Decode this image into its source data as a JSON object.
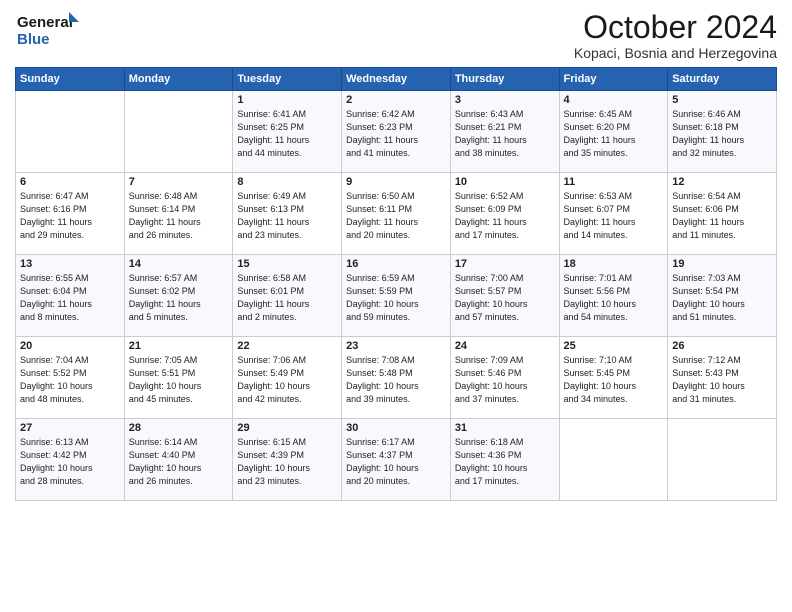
{
  "header": {
    "logo_line1": "General",
    "logo_line2": "Blue",
    "month": "October 2024",
    "location": "Kopaci, Bosnia and Herzegovina"
  },
  "weekdays": [
    "Sunday",
    "Monday",
    "Tuesday",
    "Wednesday",
    "Thursday",
    "Friday",
    "Saturday"
  ],
  "weeks": [
    [
      {
        "day": "",
        "info": ""
      },
      {
        "day": "",
        "info": ""
      },
      {
        "day": "1",
        "info": "Sunrise: 6:41 AM\nSunset: 6:25 PM\nDaylight: 11 hours\nand 44 minutes."
      },
      {
        "day": "2",
        "info": "Sunrise: 6:42 AM\nSunset: 6:23 PM\nDaylight: 11 hours\nand 41 minutes."
      },
      {
        "day": "3",
        "info": "Sunrise: 6:43 AM\nSunset: 6:21 PM\nDaylight: 11 hours\nand 38 minutes."
      },
      {
        "day": "4",
        "info": "Sunrise: 6:45 AM\nSunset: 6:20 PM\nDaylight: 11 hours\nand 35 minutes."
      },
      {
        "day": "5",
        "info": "Sunrise: 6:46 AM\nSunset: 6:18 PM\nDaylight: 11 hours\nand 32 minutes."
      }
    ],
    [
      {
        "day": "6",
        "info": "Sunrise: 6:47 AM\nSunset: 6:16 PM\nDaylight: 11 hours\nand 29 minutes."
      },
      {
        "day": "7",
        "info": "Sunrise: 6:48 AM\nSunset: 6:14 PM\nDaylight: 11 hours\nand 26 minutes."
      },
      {
        "day": "8",
        "info": "Sunrise: 6:49 AM\nSunset: 6:13 PM\nDaylight: 11 hours\nand 23 minutes."
      },
      {
        "day": "9",
        "info": "Sunrise: 6:50 AM\nSunset: 6:11 PM\nDaylight: 11 hours\nand 20 minutes."
      },
      {
        "day": "10",
        "info": "Sunrise: 6:52 AM\nSunset: 6:09 PM\nDaylight: 11 hours\nand 17 minutes."
      },
      {
        "day": "11",
        "info": "Sunrise: 6:53 AM\nSunset: 6:07 PM\nDaylight: 11 hours\nand 14 minutes."
      },
      {
        "day": "12",
        "info": "Sunrise: 6:54 AM\nSunset: 6:06 PM\nDaylight: 11 hours\nand 11 minutes."
      }
    ],
    [
      {
        "day": "13",
        "info": "Sunrise: 6:55 AM\nSunset: 6:04 PM\nDaylight: 11 hours\nand 8 minutes."
      },
      {
        "day": "14",
        "info": "Sunrise: 6:57 AM\nSunset: 6:02 PM\nDaylight: 11 hours\nand 5 minutes."
      },
      {
        "day": "15",
        "info": "Sunrise: 6:58 AM\nSunset: 6:01 PM\nDaylight: 11 hours\nand 2 minutes."
      },
      {
        "day": "16",
        "info": "Sunrise: 6:59 AM\nSunset: 5:59 PM\nDaylight: 10 hours\nand 59 minutes."
      },
      {
        "day": "17",
        "info": "Sunrise: 7:00 AM\nSunset: 5:57 PM\nDaylight: 10 hours\nand 57 minutes."
      },
      {
        "day": "18",
        "info": "Sunrise: 7:01 AM\nSunset: 5:56 PM\nDaylight: 10 hours\nand 54 minutes."
      },
      {
        "day": "19",
        "info": "Sunrise: 7:03 AM\nSunset: 5:54 PM\nDaylight: 10 hours\nand 51 minutes."
      }
    ],
    [
      {
        "day": "20",
        "info": "Sunrise: 7:04 AM\nSunset: 5:52 PM\nDaylight: 10 hours\nand 48 minutes."
      },
      {
        "day": "21",
        "info": "Sunrise: 7:05 AM\nSunset: 5:51 PM\nDaylight: 10 hours\nand 45 minutes."
      },
      {
        "day": "22",
        "info": "Sunrise: 7:06 AM\nSunset: 5:49 PM\nDaylight: 10 hours\nand 42 minutes."
      },
      {
        "day": "23",
        "info": "Sunrise: 7:08 AM\nSunset: 5:48 PM\nDaylight: 10 hours\nand 39 minutes."
      },
      {
        "day": "24",
        "info": "Sunrise: 7:09 AM\nSunset: 5:46 PM\nDaylight: 10 hours\nand 37 minutes."
      },
      {
        "day": "25",
        "info": "Sunrise: 7:10 AM\nSunset: 5:45 PM\nDaylight: 10 hours\nand 34 minutes."
      },
      {
        "day": "26",
        "info": "Sunrise: 7:12 AM\nSunset: 5:43 PM\nDaylight: 10 hours\nand 31 minutes."
      }
    ],
    [
      {
        "day": "27",
        "info": "Sunrise: 6:13 AM\nSunset: 4:42 PM\nDaylight: 10 hours\nand 28 minutes."
      },
      {
        "day": "28",
        "info": "Sunrise: 6:14 AM\nSunset: 4:40 PM\nDaylight: 10 hours\nand 26 minutes."
      },
      {
        "day": "29",
        "info": "Sunrise: 6:15 AM\nSunset: 4:39 PM\nDaylight: 10 hours\nand 23 minutes."
      },
      {
        "day": "30",
        "info": "Sunrise: 6:17 AM\nSunset: 4:37 PM\nDaylight: 10 hours\nand 20 minutes."
      },
      {
        "day": "31",
        "info": "Sunrise: 6:18 AM\nSunset: 4:36 PM\nDaylight: 10 hours\nand 17 minutes."
      },
      {
        "day": "",
        "info": ""
      },
      {
        "day": "",
        "info": ""
      }
    ]
  ]
}
